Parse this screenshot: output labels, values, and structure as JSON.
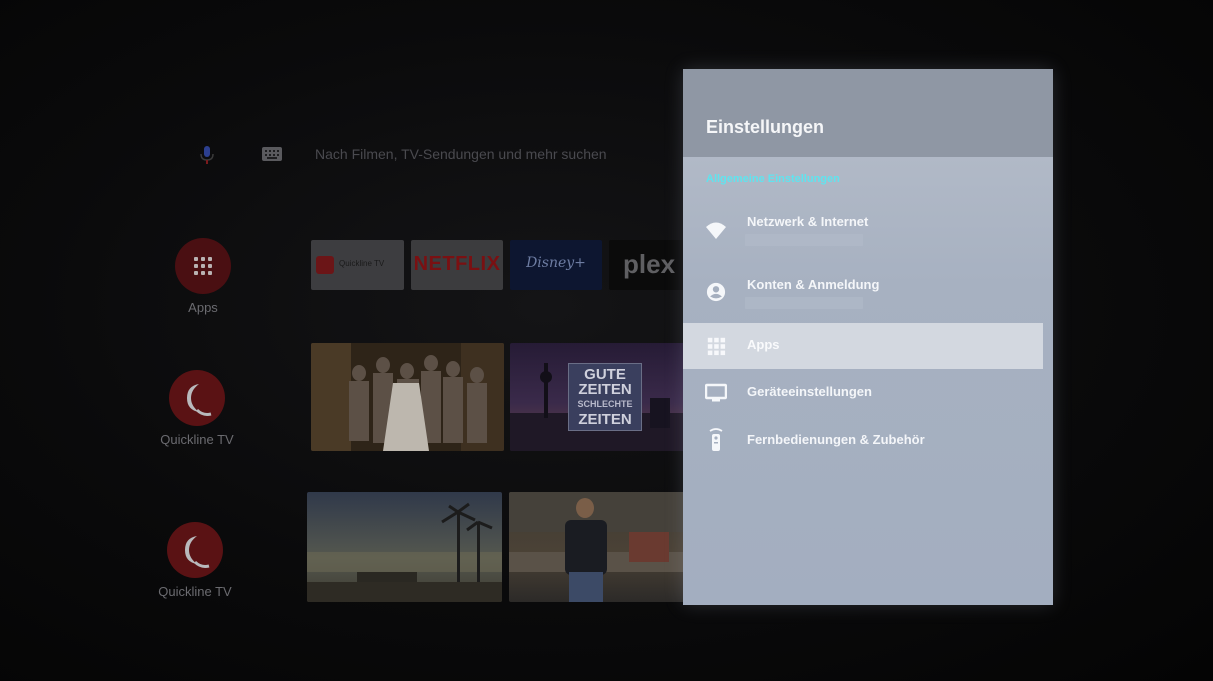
{
  "search": {
    "placeholder": "Nach Filmen, TV-Sendungen und mehr suchen",
    "mic_icon": "mic-icon",
    "keyboard_icon": "keyboard-icon"
  },
  "channels": [
    {
      "label": "Apps",
      "icon": "apps-grid-icon"
    },
    {
      "label": "Quickline TV",
      "icon": "quickline-logo-icon"
    },
    {
      "label": "Quickline TV",
      "icon": "quickline-logo-icon"
    }
  ],
  "app_tiles": [
    {
      "label": "Quickline TV"
    },
    {
      "label": "NETFLIX"
    },
    {
      "label": "Disney+"
    },
    {
      "label": "plex"
    }
  ],
  "thumbnails": {
    "gzsz_line1": "GUTE",
    "gzsz_line2": "ZEITEN",
    "gzsz_line3": "SCHLECHTE",
    "gzsz_line4": "ZEITEN"
  },
  "settings": {
    "title": "Einstellungen",
    "section": "Allgemeine Einstellungen",
    "items": [
      {
        "label": "Netzwerk & Internet",
        "icon": "wifi-icon",
        "selected": false
      },
      {
        "label": "Konten & Anmeldung",
        "icon": "account-icon",
        "selected": false
      },
      {
        "label": "Apps",
        "icon": "apps-grid-icon",
        "selected": true
      },
      {
        "label": "Geräteeinstellungen",
        "icon": "tv-icon",
        "selected": false
      },
      {
        "label": "Fernbedienungen & Zubehör",
        "icon": "remote-icon",
        "selected": false
      }
    ]
  },
  "colors": {
    "accent_section": "#5fe4ef",
    "panel_bg": "#a7b1c1",
    "panel_header": "#8f97a4",
    "selected_row": "#d3d8e0",
    "mic_blue": "#3b5bd6",
    "mic_red": "#c2252a"
  }
}
